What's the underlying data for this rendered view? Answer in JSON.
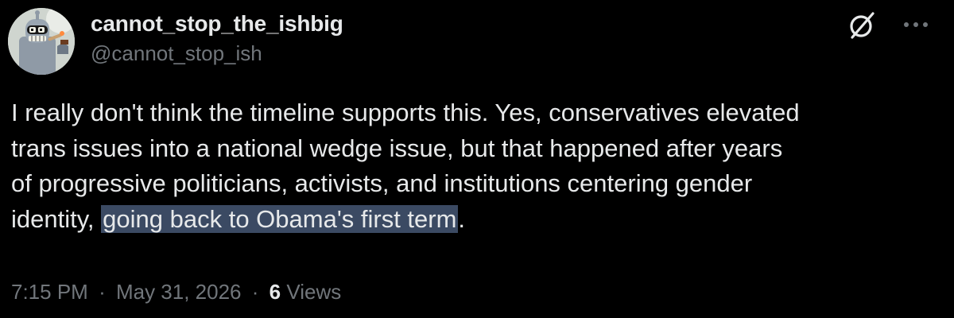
{
  "author": {
    "display_name": "cannot_stop_the_ishbig",
    "handle": "@cannot_stop_ish",
    "avatar_icon": "robot-avatar-icon"
  },
  "actions": {
    "grok_icon": "slashed-circle-icon",
    "more_icon": "more-dots-icon"
  },
  "tweet": {
    "line1": "I really don't think the timeline supports this. Yes, conservatives elevated",
    "line2": "trans issues into a national wedge issue, but that happened after years",
    "line3": "of progressive politicians, activists, and institutions centering gender",
    "line4_start": "identity, ",
    "line4_highlight": "going back to Obama's first term",
    "line4_end": "."
  },
  "meta": {
    "time": "7:15 PM",
    "separator": "·",
    "date": "May 31, 2026",
    "views_count": "6",
    "views_label": "Views"
  },
  "colors": {
    "background": "#000000",
    "primary_text": "#e7e9ea",
    "secondary_text": "#71767b",
    "highlight": "#3b4a63"
  }
}
